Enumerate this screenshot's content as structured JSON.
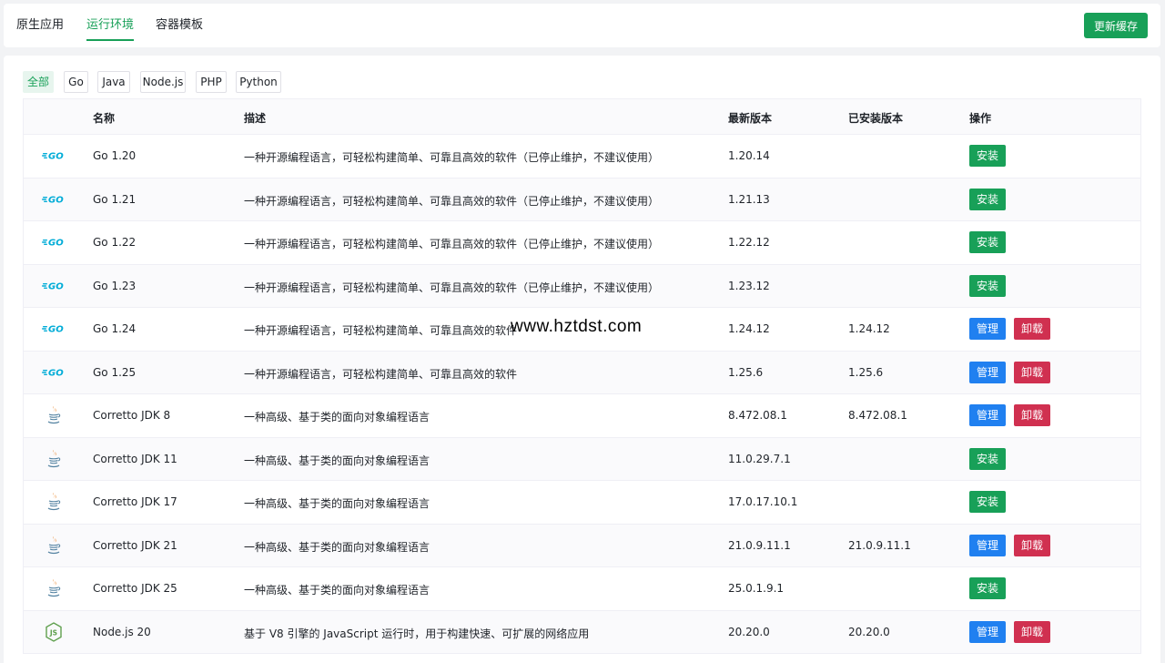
{
  "tabs": [
    {
      "label": "原生应用",
      "active": false
    },
    {
      "label": "运行环境",
      "active": true
    },
    {
      "label": "容器模板",
      "active": false
    }
  ],
  "refresh_label": "更新缓存",
  "filters": [
    {
      "label": "全部",
      "active": true
    },
    {
      "label": "Go",
      "active": false
    },
    {
      "label": "Java",
      "active": false
    },
    {
      "label": "Node.js",
      "active": false
    },
    {
      "label": "PHP",
      "active": false
    },
    {
      "label": "Python",
      "active": false
    }
  ],
  "columns": {
    "name": "名称",
    "description": "描述",
    "latest": "最新版本",
    "installed": "已安装版本",
    "actions": "操作"
  },
  "actions": {
    "install": "安装",
    "manage": "管理",
    "uninstall": "卸载"
  },
  "rows": [
    {
      "icon": "go-icon",
      "name": "Go 1.20",
      "description": "一种开源编程语言，可轻松构建简单、可靠且高效的软件（已停止维护，不建议使用）",
      "latest": "1.20.14",
      "installed": ""
    },
    {
      "icon": "go-icon",
      "name": "Go 1.21",
      "description": "一种开源编程语言，可轻松构建简单、可靠且高效的软件（已停止维护，不建议使用）",
      "latest": "1.21.13",
      "installed": ""
    },
    {
      "icon": "go-icon",
      "name": "Go 1.22",
      "description": "一种开源编程语言，可轻松构建简单、可靠且高效的软件（已停止维护，不建议使用）",
      "latest": "1.22.12",
      "installed": ""
    },
    {
      "icon": "go-icon",
      "name": "Go 1.23",
      "description": "一种开源编程语言，可轻松构建简单、可靠且高效的软件（已停止维护，不建议使用）",
      "latest": "1.23.12",
      "installed": ""
    },
    {
      "icon": "go-icon",
      "name": "Go 1.24",
      "description": "一种开源编程语言，可轻松构建简单、可靠且高效的软件",
      "latest": "1.24.12",
      "installed": "1.24.12"
    },
    {
      "icon": "go-icon",
      "name": "Go 1.25",
      "description": "一种开源编程语言，可轻松构建简单、可靠且高效的软件",
      "latest": "1.25.6",
      "installed": "1.25.6"
    },
    {
      "icon": "java-icon",
      "name": "Corretto JDK 8",
      "description": "一种高级、基于类的面向对象编程语言",
      "latest": "8.472.08.1",
      "installed": "8.472.08.1"
    },
    {
      "icon": "java-icon",
      "name": "Corretto JDK 11",
      "description": "一种高级、基于类的面向对象编程语言",
      "latest": "11.0.29.7.1",
      "installed": ""
    },
    {
      "icon": "java-icon",
      "name": "Corretto JDK 17",
      "description": "一种高级、基于类的面向对象编程语言",
      "latest": "17.0.17.10.1",
      "installed": ""
    },
    {
      "icon": "java-icon",
      "name": "Corretto JDK 21",
      "description": "一种高级、基于类的面向对象编程语言",
      "latest": "21.0.9.11.1",
      "installed": "21.0.9.11.1"
    },
    {
      "icon": "java-icon",
      "name": "Corretto JDK 25",
      "description": "一种高级、基于类的面向对象编程语言",
      "latest": "25.0.1.9.1",
      "installed": ""
    },
    {
      "icon": "nodejs-icon",
      "name": "Node.js 20",
      "description": "基于 V8 引擎的 JavaScript 运行时，用于构建快速、可扩展的网络应用",
      "latest": "20.20.0",
      "installed": "20.20.0"
    }
  ],
  "watermark": "www.hztdst.com",
  "colors": {
    "primary": "#18a058",
    "info": "#2080f0",
    "error": "#d03050",
    "go": "#00acd7"
  }
}
